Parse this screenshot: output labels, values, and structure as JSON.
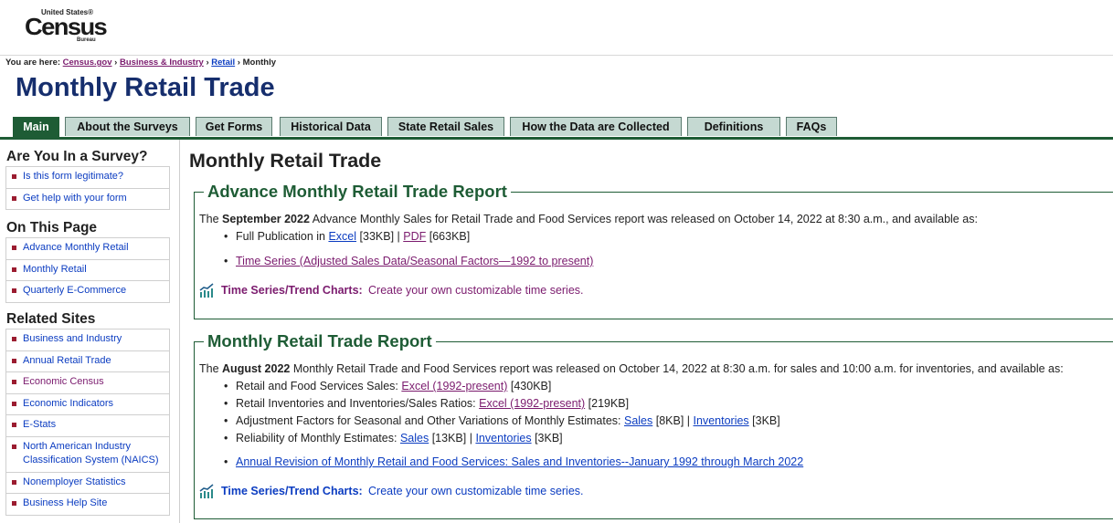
{
  "header": {
    "logo_top": "United States®",
    "logo_main": "Census",
    "logo_bottom": "Bureau",
    "breadcrumb_prefix": "You are here:",
    "breadcrumbs": [
      "Census.gov",
      "Business & Industry",
      "Retail"
    ],
    "breadcrumb_current": "Monthly",
    "title": "Monthly Retail Trade"
  },
  "tabs": [
    "Main",
    "About the Surveys",
    "Get Forms",
    "Historical Data",
    "State Retail Sales",
    "How the Data are Collected",
    "Definitions",
    "FAQs"
  ],
  "sidebar": {
    "survey_heading": "Are You In a Survey?",
    "survey_items": [
      "Is this form legitimate?",
      "Get help with your form"
    ],
    "page_heading": "On This Page",
    "page_items": [
      "Advance Monthly Retail",
      "Monthly Retail",
      "Quarterly E-Commerce"
    ],
    "related_heading": "Related Sites",
    "related_items": [
      "Business and Industry",
      "Annual Retail Trade",
      "Economic Census",
      "Economic Indicators",
      "E-Stats",
      "North American Industry Classification System (NAICS)",
      "Nonemployer Statistics",
      "Business Help Site"
    ]
  },
  "main": {
    "title": "Monthly Retail Trade",
    "advance": {
      "legend": "Advance Monthly Retail Trade Report",
      "intro_pre": "The",
      "intro_bold": "September 2022",
      "intro_post": "Advance Monthly Sales for Retail Trade and Food Services report was released on October 14, 2022 at 8:30 a.m., and available as:",
      "pub_label": "Full Publication in",
      "excel": "Excel",
      "excel_size": "[33KB] |",
      "pdf": "PDF",
      "pdf_size": "[663KB]",
      "timeseries_link": "Time Series (Adjusted Sales Data/Seasonal Factors—1992 to present)",
      "trend_label": "Time Series/Trend Charts:",
      "trend_text": "Create your own customizable time series."
    },
    "monthly": {
      "legend": "Monthly Retail Trade Report",
      "intro_pre": "The",
      "intro_bold": "August 2022",
      "intro_post": "Monthly Retail Trade and Food Services report was released on October 14, 2022 at 8:30 a.m. for sales and 10:00 a.m. for inventories, and available as:",
      "sales_label": "Retail and Food Services Sales:",
      "sales_link": "Excel (1992-present)",
      "sales_size": "[430KB]",
      "inv_label": "Retail Inventories and Inventories/Sales Ratios:",
      "inv_link": "Excel (1992-present)",
      "inv_size": "[219KB]",
      "adj_label": "Adjustment Factors for Seasonal and Other Variations of Monthly Estimates:",
      "adj_sales": "Sales",
      "adj_sales_size": "[8KB] |",
      "adj_inv": "Inventories",
      "adj_inv_size": "[3KB]",
      "rel_label": "Reliability of Monthly Estimates:",
      "rel_sales": "Sales",
      "rel_sales_size": "[13KB] |",
      "rel_inv": "Inventories",
      "rel_inv_size": "[3KB]",
      "annual_link": "Annual Revision of Monthly Retail and Food Services: Sales and Inventories--January 1992 through March 2022",
      "trend_label": "Time Series/Trend Charts:",
      "trend_text": "Create your own customizable time series."
    }
  },
  "colors": {
    "brand_green": "#1e5c35",
    "title_navy": "#162e6d",
    "link_blue": "#0b3cc1",
    "visited_purple": "#7b1b6e",
    "tab_bg": "#c5d9d2",
    "bullet_red": "#9b1c30"
  },
  "icons": [
    "trend-chart-icon"
  ]
}
